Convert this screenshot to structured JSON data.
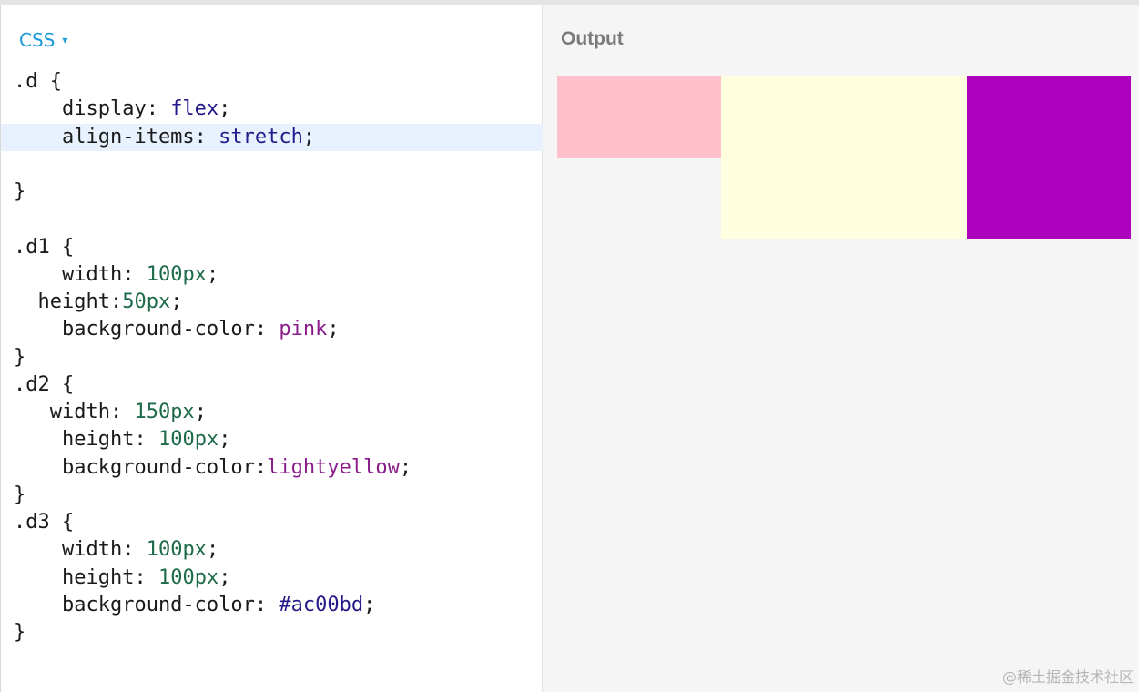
{
  "editor": {
    "language_label": "CSS",
    "caret": "▾",
    "lines": [
      [
        {
          "t": ".d {",
          "c": ""
        }
      ],
      [
        {
          "t": "    display: ",
          "c": ""
        },
        {
          "t": "flex",
          "c": "k-kw"
        },
        {
          "t": ";",
          "c": ""
        }
      ],
      [
        {
          "t": "    align-items: ",
          "c": ""
        },
        {
          "t": "stretch",
          "c": "k-kw"
        },
        {
          "t": ";",
          "c": ""
        }
      ],
      [
        {
          "t": "",
          "c": ""
        }
      ],
      [
        {
          "t": "}",
          "c": ""
        }
      ],
      [
        {
          "t": "",
          "c": ""
        }
      ],
      [
        {
          "t": ".d1 {",
          "c": ""
        }
      ],
      [
        {
          "t": "    width: ",
          "c": ""
        },
        {
          "t": "100px",
          "c": "k-num"
        },
        {
          "t": ";",
          "c": ""
        }
      ],
      [
        {
          "t": "  height:",
          "c": ""
        },
        {
          "t": "50px",
          "c": "k-num"
        },
        {
          "t": ";",
          "c": ""
        }
      ],
      [
        {
          "t": "    background-color: ",
          "c": ""
        },
        {
          "t": "pink",
          "c": "k-color"
        },
        {
          "t": ";",
          "c": ""
        }
      ],
      [
        {
          "t": "}",
          "c": ""
        }
      ],
      [
        {
          "t": ".d2 {",
          "c": ""
        }
      ],
      [
        {
          "t": "   width: ",
          "c": ""
        },
        {
          "t": "150px",
          "c": "k-num"
        },
        {
          "t": ";",
          "c": ""
        }
      ],
      [
        {
          "t": "    height: ",
          "c": ""
        },
        {
          "t": "100px",
          "c": "k-num"
        },
        {
          "t": ";",
          "c": ""
        }
      ],
      [
        {
          "t": "    background-color:",
          "c": ""
        },
        {
          "t": "lightyellow",
          "c": "k-color"
        },
        {
          "t": ";",
          "c": ""
        }
      ],
      [
        {
          "t": "}",
          "c": ""
        }
      ],
      [
        {
          "t": ".d3 {",
          "c": ""
        }
      ],
      [
        {
          "t": "    width: ",
          "c": ""
        },
        {
          "t": "100px",
          "c": "k-num"
        },
        {
          "t": ";",
          "c": ""
        }
      ],
      [
        {
          "t": "    height: ",
          "c": ""
        },
        {
          "t": "100px",
          "c": "k-num"
        },
        {
          "t": ";",
          "c": ""
        }
      ],
      [
        {
          "t": "    background-color: ",
          "c": ""
        },
        {
          "t": "#ac00bd",
          "c": "k-hex"
        },
        {
          "t": ";",
          "c": ""
        }
      ],
      [
        {
          "t": "}",
          "c": ""
        }
      ]
    ],
    "active_line": 2
  },
  "output": {
    "title": "Output",
    "boxes": [
      {
        "name": "d1",
        "color": "#ffc0cb"
      },
      {
        "name": "d2",
        "color": "#ffffe0"
      },
      {
        "name": "d3",
        "color": "#ac00bd"
      }
    ]
  },
  "watermark": "@稀土掘金技术社区",
  "colors": {
    "accent": "#1a9bd7",
    "keyword": "#251a8a",
    "number": "#1e6b4a",
    "color_value": "#8b1d8b",
    "active_line_bg": "#e8f2fe"
  }
}
